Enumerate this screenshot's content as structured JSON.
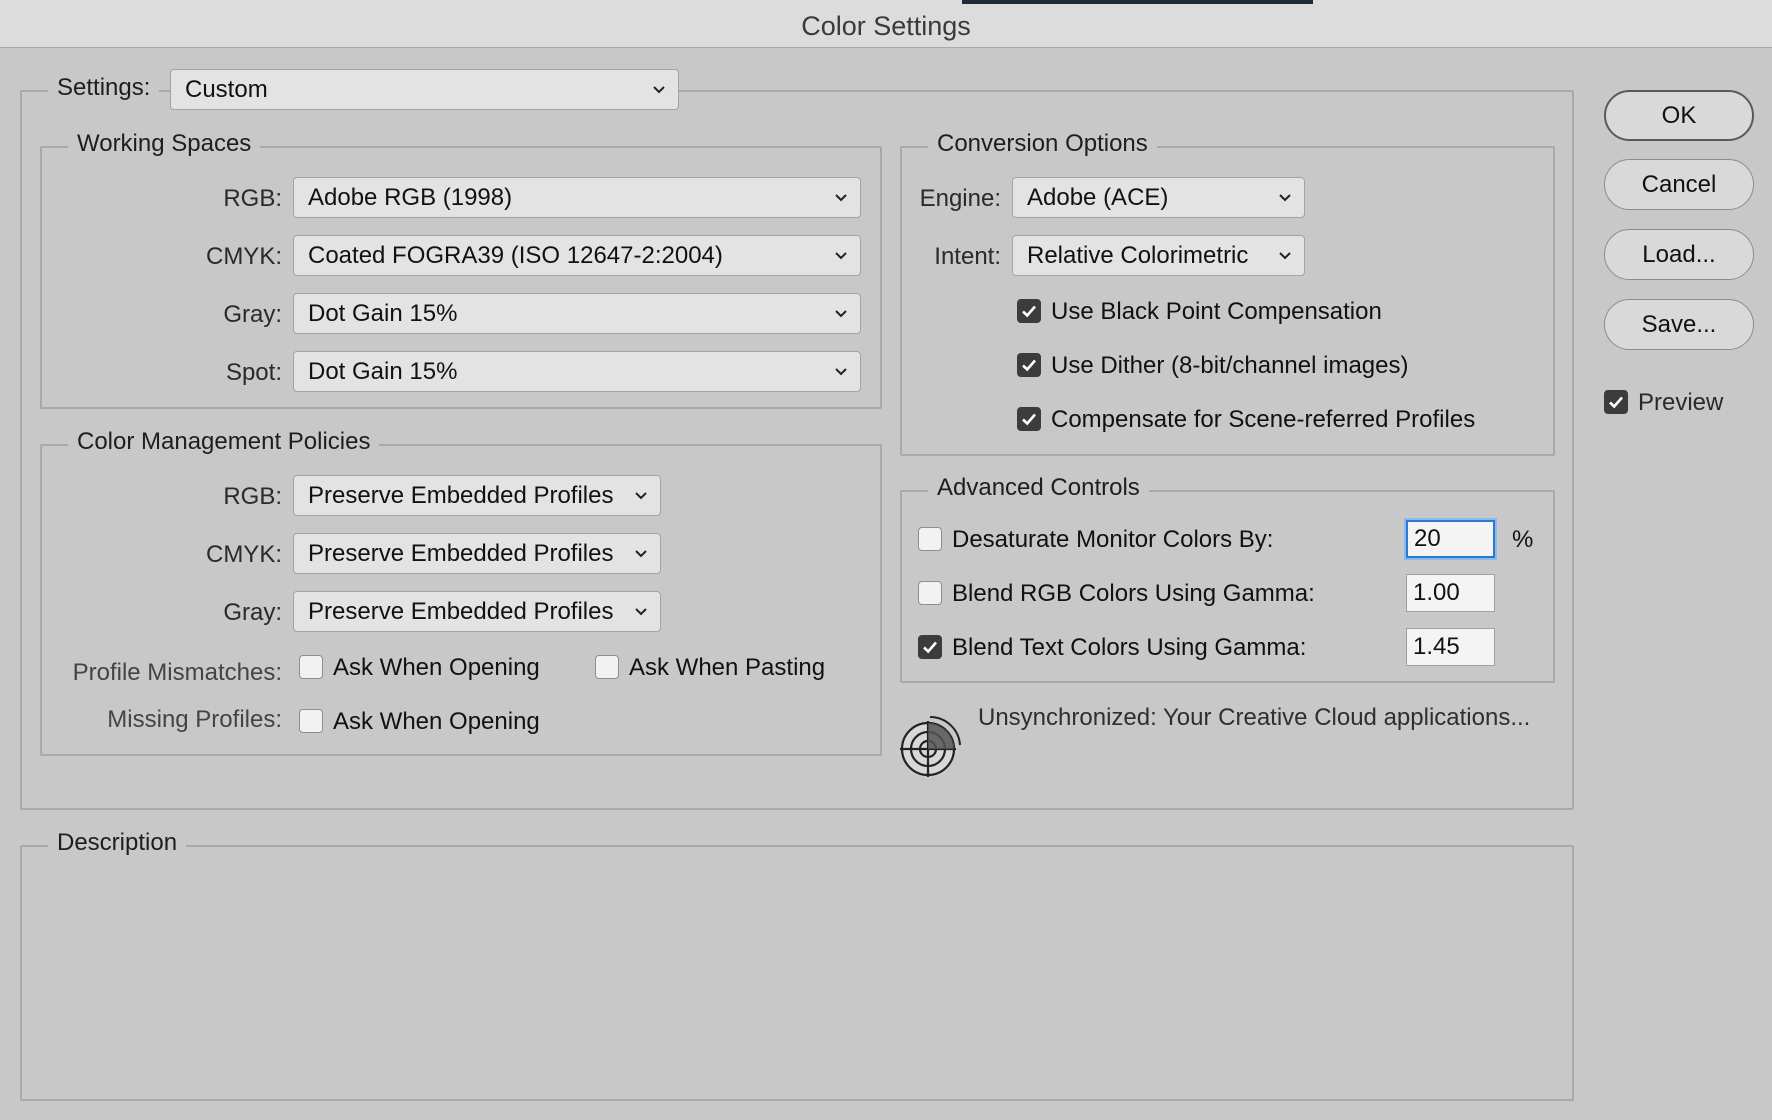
{
  "window": {
    "title": "Color Settings"
  },
  "settings": {
    "label": "Settings:",
    "value": "Custom"
  },
  "working_spaces": {
    "title": "Working Spaces",
    "rgb": {
      "label": "RGB:",
      "value": "Adobe RGB (1998)"
    },
    "cmyk": {
      "label": "CMYK:",
      "value": "Coated FOGRA39 (ISO 12647-2:2004)"
    },
    "gray": {
      "label": "Gray:",
      "value": "Dot Gain 15%"
    },
    "spot": {
      "label": "Spot:",
      "value": "Dot Gain 15%"
    }
  },
  "policies": {
    "title": "Color Management Policies",
    "rgb": {
      "label": "RGB:",
      "value": "Preserve Embedded Profiles"
    },
    "cmyk": {
      "label": "CMYK:",
      "value": "Preserve Embedded Profiles"
    },
    "gray": {
      "label": "Gray:",
      "value": "Preserve Embedded Profiles"
    },
    "mismatches": {
      "label": "Profile Mismatches:",
      "ask_opening": {
        "label": "Ask When Opening",
        "checked": false
      },
      "ask_pasting": {
        "label": "Ask When Pasting",
        "checked": false
      }
    },
    "missing": {
      "label": "Missing Profiles:",
      "ask_opening": {
        "label": "Ask When Opening",
        "checked": false
      }
    }
  },
  "conversion": {
    "title": "Conversion Options",
    "engine": {
      "label": "Engine:",
      "value": "Adobe (ACE)"
    },
    "intent": {
      "label": "Intent:",
      "value": "Relative Colorimetric"
    },
    "black_point": {
      "label": "Use Black Point Compensation",
      "checked": true
    },
    "dither": {
      "label": "Use Dither (8-bit/channel images)",
      "checked": true
    },
    "scene": {
      "label": "Compensate for Scene-referred Profiles",
      "checked": true
    }
  },
  "advanced": {
    "title": "Advanced Controls",
    "desaturate": {
      "label": "Desaturate Monitor Colors By:",
      "checked": false,
      "value": "20",
      "unit": "%"
    },
    "blend_rgb": {
      "label": "Blend RGB Colors Using Gamma:",
      "checked": false,
      "value": "1.00"
    },
    "blend_text": {
      "label": "Blend Text Colors Using Gamma:",
      "checked": true,
      "value": "1.45"
    }
  },
  "sync": {
    "text": "Unsynchronized: Your Creative Cloud applications...",
    "icon": "sync-globe-icon"
  },
  "description": {
    "title": "Description"
  },
  "buttons": {
    "ok": "OK",
    "cancel": "Cancel",
    "load": "Load...",
    "save": "Save..."
  },
  "preview": {
    "label": "Preview",
    "checked": true
  },
  "colors": {
    "background": "#c8c8c8",
    "focus": "#2a78d6",
    "checked": "#3c3c3c"
  }
}
